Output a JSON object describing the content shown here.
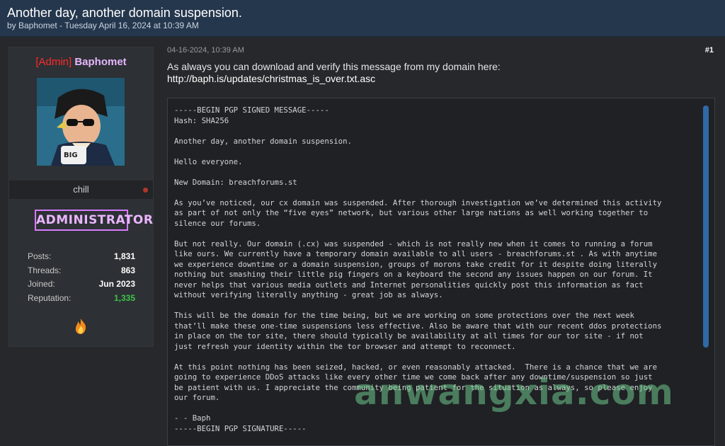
{
  "thread": {
    "title": "Another day, another domain suspension.",
    "meta": "by Baphomet - Tuesday April 16, 2024 at 10:39 AM"
  },
  "user": {
    "tag": "[Admin]",
    "name": "Baphomet",
    "status": "chill",
    "role": "ADMINISTRATOR",
    "stats": [
      {
        "label": "Posts:",
        "value": "1,831"
      },
      {
        "label": "Threads:",
        "value": "863"
      },
      {
        "label": "Joined:",
        "value": "Jun 2023"
      },
      {
        "label": "Reputation:",
        "value": "1,335"
      }
    ],
    "icon": "flame-icon"
  },
  "post": {
    "date": "04-16-2024, 10:39 AM",
    "number": "#1",
    "intro": "As always you can download and verify this message from my domain here:",
    "link": "http://baph.is/updates/christmas_is_over.txt.asc",
    "code": "-----BEGIN PGP SIGNED MESSAGE-----\nHash: SHA256\n\nAnother day, another domain suspension.\n\nHello everyone.\n\nNew Domain: breachforums.st\n\nAs you’ve noticed, our cx domain was suspended. After thorough investigation we’ve determined this activity\nas part of not only the “five eyes” network, but various other large nations as well working together to\nsilence our forums.\n\nBut not really. Our domain (.cx) was suspended - which is not really new when it comes to running a forum\nlike ours. We currently have a temporary domain available to all users - breachforums.st . As with anytime\nwe experience downtime or a domain suspension, groups of morons take credit for it despite doing literally\nnothing but smashing their little pig fingers on a keyboard the second any issues happen on our forum. It\nnever helps that various media outlets and Internet personalities quickly post this information as fact\nwithout verifying literally anything - great job as always.\n\nThis will be the domain for the time being, but we are working on some protections over the next week\nthat’ll make these one-time suspensions less effective. Also be aware that with our recent ddos protections\nin place on the tor site, there should typically be availability at all times for our tor site - if not\njust refresh your identity within the tor browser and attempt to reconnect.\n\nAt this point nothing has been seized, hacked, or even reasonably attacked.  There is a chance that we are\ngoing to experience DDoS attacks like every other time we come back after any downtime/suspension so just\nbe patient with us. I appreciate the community being patient for the situation as always, so please enjoy\nour forum.\n\n- - Baph\n-----BEGIN PGP SIGNATURE-----"
  },
  "watermark": "anwangxia.com",
  "colors": {
    "header": "#25374d",
    "admin_tag": "#ff2a2a",
    "username": "#e6b6ff",
    "role_border": "#d77bff",
    "reputation": "#3ec24a",
    "scrollbar": "#2f6aa6"
  }
}
